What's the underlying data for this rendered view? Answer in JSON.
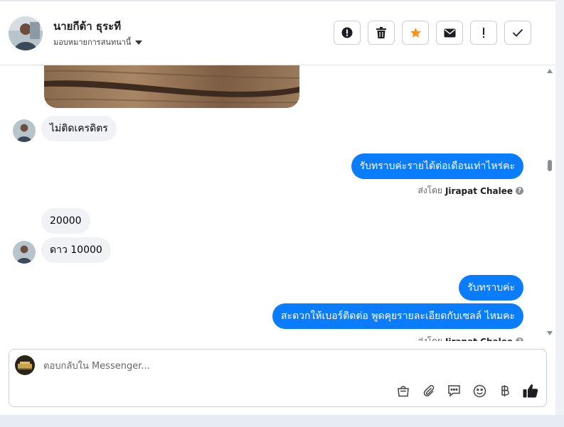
{
  "header": {
    "contact_name": "นายกีต้า ธุระที",
    "assignment_label": "มอบหมายการสนทนานี้",
    "actions": [
      {
        "name": "alert",
        "icon": "exclamation-circle-icon"
      },
      {
        "name": "delete",
        "icon": "trash-icon"
      },
      {
        "name": "star",
        "icon": "star-icon",
        "color": "#f7931e"
      },
      {
        "name": "mark-unread",
        "icon": "envelope-icon"
      },
      {
        "name": "follow-up",
        "icon": "exclamation-icon"
      },
      {
        "name": "done",
        "icon": "checkmark-icon"
      }
    ]
  },
  "messages": [
    {
      "direction": "in",
      "text": "ไม่ติดเครดิตร"
    },
    {
      "direction": "out",
      "text": "รับทราบค่ะรายได้ต่อเดือนเท่าไหร่คะ"
    },
    {
      "direction": "in",
      "text": "20000"
    },
    {
      "direction": "in",
      "text": "ดาว 10000"
    },
    {
      "direction": "out",
      "text": "รับทราบค่ะ"
    },
    {
      "direction": "out",
      "text": "สะดวกให้เบอร์ติดต่อ พูดคุยรายละเอียดกับเซลล์ ไหมคะ"
    }
  ],
  "sent_by": {
    "prefix": "ส่งโดย",
    "agent": "Jirapat Chalee"
  },
  "reply": {
    "placeholder": "ตอบกลับใน Messenger...",
    "tools": [
      "shopping-bag-icon",
      "paperclip-icon",
      "saved-reply-icon",
      "emoji-icon",
      "baht-icon",
      "thumbs-up-icon"
    ]
  },
  "colors": {
    "outgoing_bubble": "#0a7cff",
    "incoming_bubble": "#f0f2f5",
    "star": "#f7931e"
  }
}
